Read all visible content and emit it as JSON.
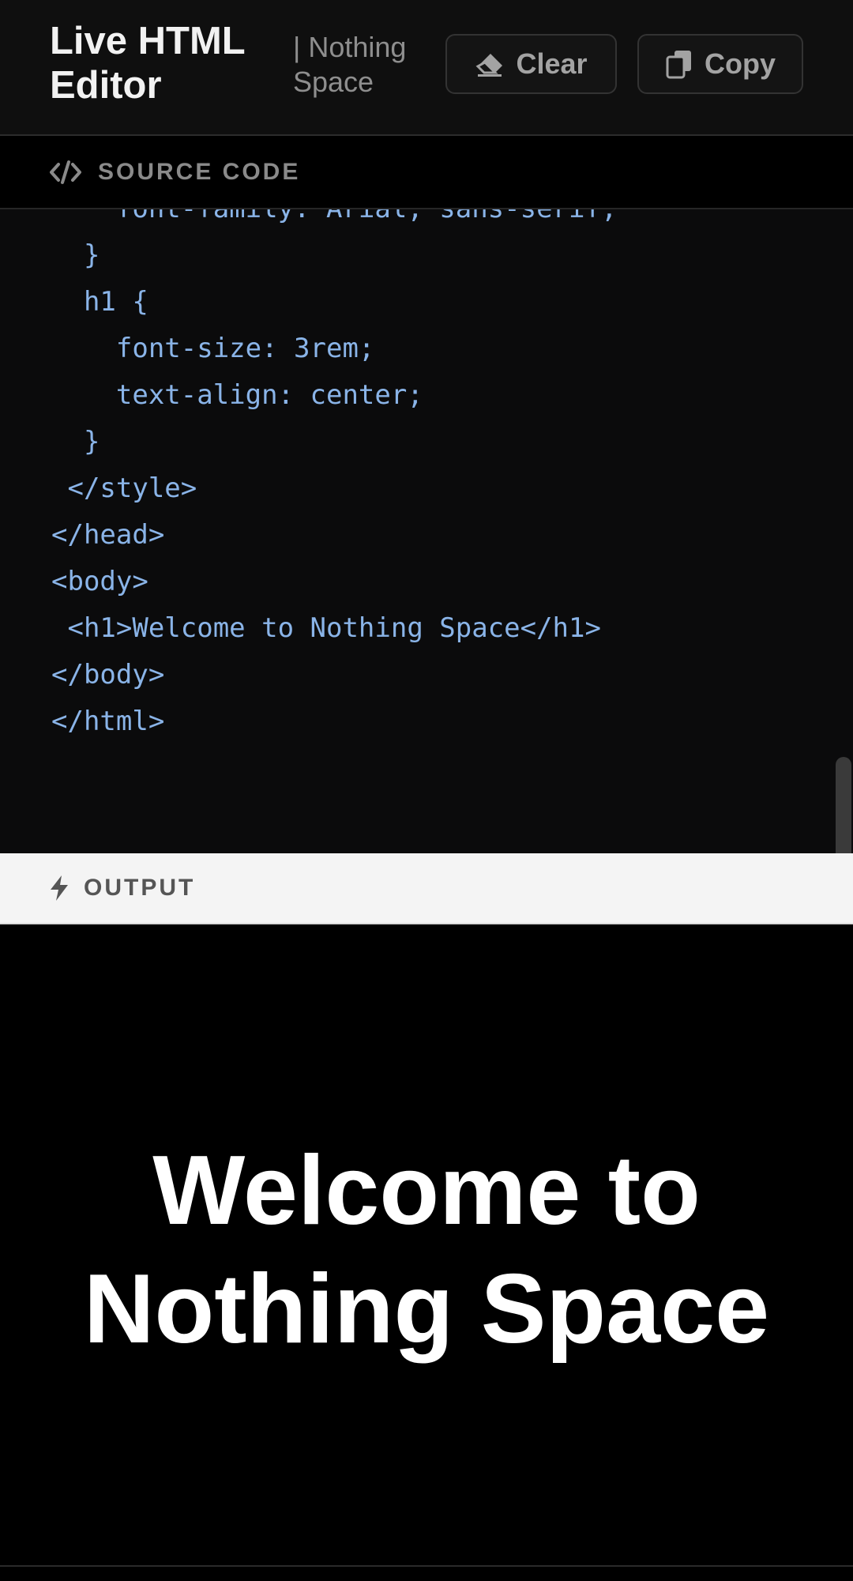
{
  "header": {
    "title": "Live HTML Editor",
    "subtitle": "| Nothing Space",
    "clear_label": "Clear",
    "copy_label": "Copy"
  },
  "source_panel": {
    "label": "SOURCE CODE",
    "icon": "code-icon",
    "lines": [
      "    font-family: Arial, sans-serif;",
      "  }",
      "  h1 {",
      "    font-size: 3rem;",
      "    text-align: center;",
      "  }",
      " </style>",
      "</head>",
      "<body>",
      " <h1>Welcome to Nothing Space</h1>",
      "</body>",
      "</html>"
    ]
  },
  "output_panel": {
    "label": "OUTPUT",
    "icon": "bolt-icon",
    "heading": "Welcome to Nothing Space"
  },
  "colors": {
    "code_text": "#8ab4e8",
    "header_bg": "#0f0f0f",
    "output_bar_bg": "#f4f4f4"
  }
}
